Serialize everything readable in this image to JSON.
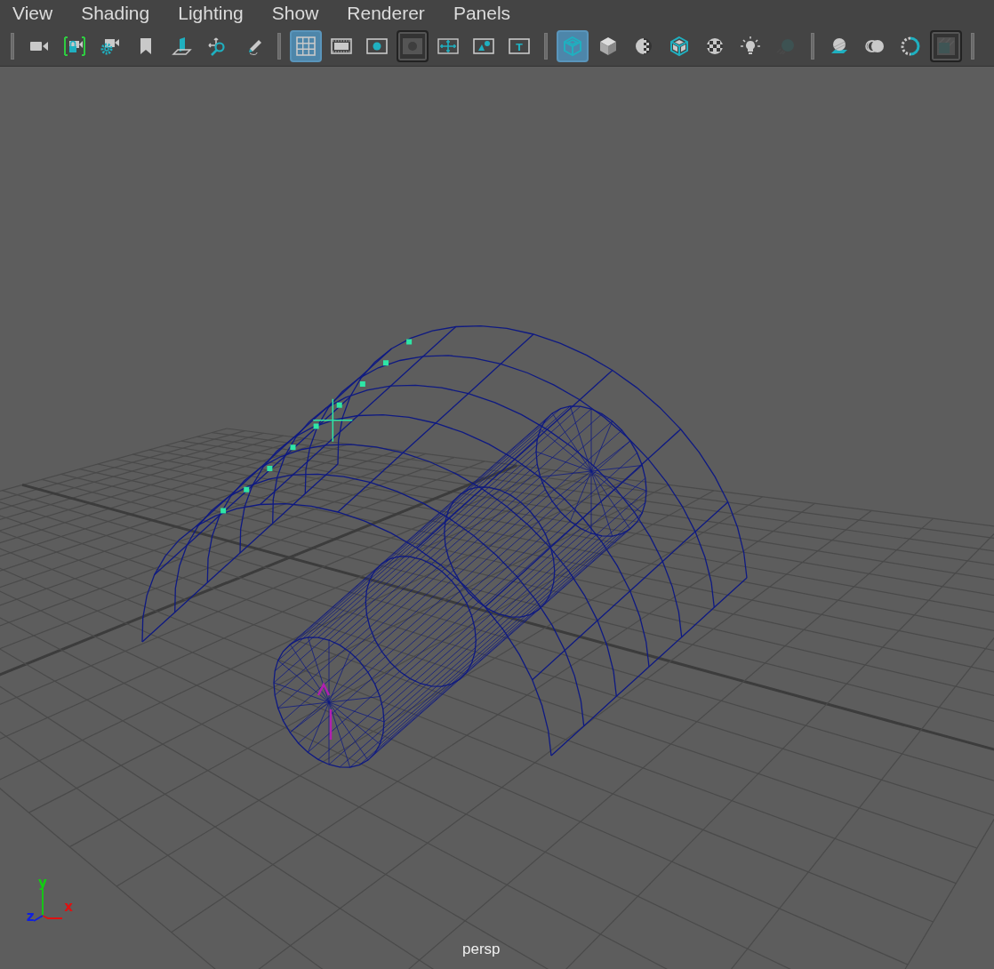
{
  "menu_bar": [
    "View",
    "Shading",
    "Lighting",
    "Show",
    "Renderer",
    "Panels"
  ],
  "toolbar": [
    {
      "kind": "separator"
    },
    {
      "kind": "camera",
      "on": false,
      "pressed": false
    },
    {
      "kind": "camera-lock",
      "on": false,
      "pressed": false
    },
    {
      "kind": "camera-gear",
      "on": false,
      "pressed": false
    },
    {
      "kind": "bookmark",
      "on": false,
      "pressed": false
    },
    {
      "kind": "plane",
      "on": false,
      "pressed": false
    },
    {
      "kind": "move-magnifier",
      "on": false,
      "pressed": false
    },
    {
      "kind": "pencil",
      "on": false,
      "pressed": false
    },
    {
      "kind": "separator"
    },
    {
      "kind": "grid",
      "on": true,
      "pressed": false
    },
    {
      "kind": "film",
      "on": false,
      "pressed": false
    },
    {
      "kind": "circle-fill",
      "on": false,
      "pressed": false
    },
    {
      "kind": "circle-dark",
      "on": false,
      "pressed": true
    },
    {
      "kind": "crosshair",
      "on": false,
      "pressed": false
    },
    {
      "kind": "image",
      "on": false,
      "pressed": false
    },
    {
      "kind": "text-box",
      "glyph": "T",
      "on": false,
      "pressed": false
    },
    {
      "kind": "separator"
    },
    {
      "kind": "wire-cube",
      "on": true,
      "pressed": false
    },
    {
      "kind": "solid-cube",
      "on": false,
      "pressed": false
    },
    {
      "kind": "half-checker",
      "on": false,
      "pressed": false
    },
    {
      "kind": "textured-cube",
      "on": false,
      "pressed": false
    },
    {
      "kind": "checker-sphere",
      "on": false,
      "pressed": false
    },
    {
      "kind": "bulb",
      "on": false,
      "pressed": false
    },
    {
      "kind": "dim-sphere",
      "on": false,
      "pressed": false
    },
    {
      "kind": "separator"
    },
    {
      "kind": "sphere-plane",
      "on": false,
      "pressed": false
    },
    {
      "kind": "double-circle",
      "on": false,
      "pressed": false
    },
    {
      "kind": "dotted-ring",
      "on": false,
      "pressed": false
    },
    {
      "kind": "square-dark",
      "on": false,
      "pressed": true
    },
    {
      "kind": "separator"
    }
  ],
  "viewport": {
    "axis_labels": [
      {
        "text": "x"
      },
      {
        "text": "y"
      },
      {
        "text": "z"
      }
    ],
    "camera_label": "persp"
  }
}
